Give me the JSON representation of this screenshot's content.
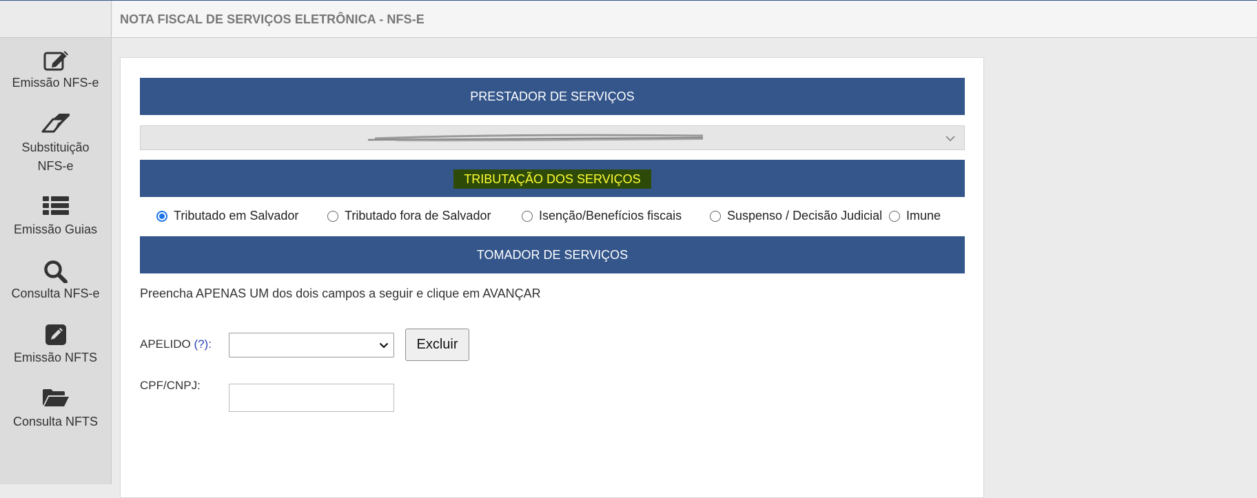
{
  "header": {
    "title": "NOTA FISCAL DE SERVIÇOS ELETRÔNICA - NFS-E"
  },
  "sidebar": {
    "items": [
      {
        "line1": "Emissão NFS-e",
        "line2": "",
        "icon": "edit-icon"
      },
      {
        "line1": "Substituição",
        "line2": "NFS-e",
        "icon": "eraser-icon"
      },
      {
        "line1": "Emissão Guias",
        "line2": "",
        "icon": "list-icon"
      },
      {
        "line1": "Consulta NFS-e",
        "line2": "",
        "icon": "search-icon"
      },
      {
        "line1": "Emissão NFTS",
        "line2": "",
        "icon": "pencil-square-icon"
      },
      {
        "line1": "Consulta NFTS",
        "line2": "",
        "icon": "folder-open-icon"
      }
    ]
  },
  "form": {
    "prestador_heading": "PRESTADOR DE SERVIÇOS",
    "prestador_select_value": "",
    "tributacao_heading": "TRIBUTAÇÃO DOS SERVIÇOS",
    "tributacao_options": [
      {
        "label": "Tributado em Salvador",
        "checked": true
      },
      {
        "label": "Tributado fora de Salvador",
        "checked": false
      },
      {
        "label": "Isenção/Benefícios fiscais",
        "checked": false
      },
      {
        "label": "Suspenso / Decisão Judicial",
        "checked": false
      },
      {
        "label": "Imune",
        "checked": false
      }
    ],
    "tomador_heading": "TOMADOR DE SERVIÇOS",
    "instruction": "Preencha APENAS UM dos dois campos a seguir e clique em AVANÇAR",
    "apelido_label": "APELIDO",
    "apelido_help": "(?):",
    "apelido_value": "",
    "excluir_label": "Excluir",
    "cpf_label": "CPF/CNPJ:",
    "cpf_value": ""
  },
  "colors": {
    "bar_blue": "#34568b",
    "highlight_bg": "#2e4a08",
    "highlight_text": "#ffff33",
    "radio_accent": "#1a73e8"
  }
}
